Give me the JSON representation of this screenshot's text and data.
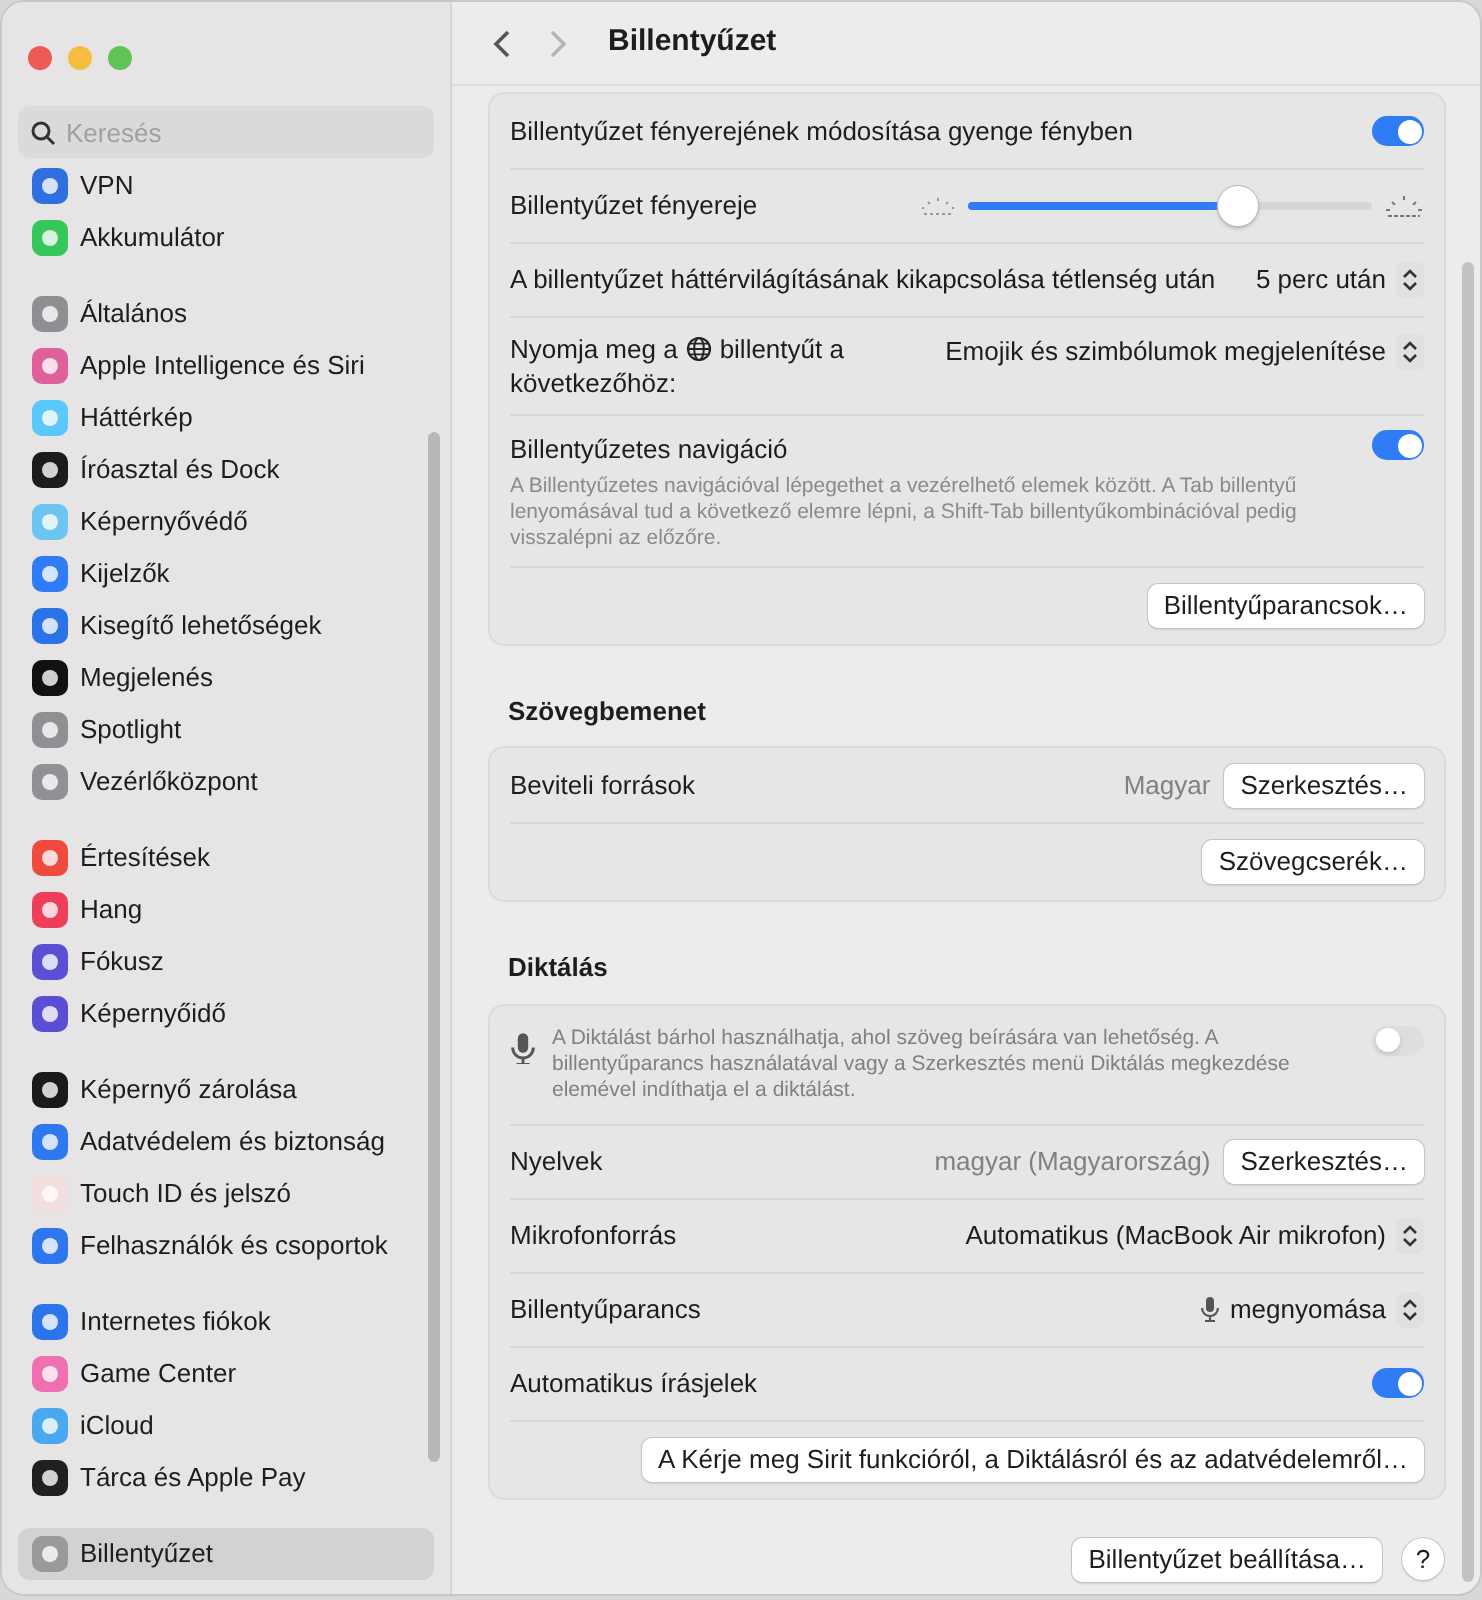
{
  "sidebar": {
    "search": {
      "placeholder": "Keresés"
    },
    "groups": [
      [
        {
          "label": "VPN",
          "color": "#2f6fe0",
          "selected": false
        },
        {
          "label": "Akkumulátor",
          "color": "#34c759",
          "selected": false
        }
      ],
      [
        {
          "label": "Általános",
          "color": "#8e8e93",
          "selected": false
        },
        {
          "label": "Apple Intelligence és Siri",
          "color": "#e0609a",
          "selected": false
        },
        {
          "label": "Háttérkép",
          "color": "#5ac8fa",
          "selected": false
        },
        {
          "label": "Íróasztal és Dock",
          "color": "#1c1c1e",
          "selected": false
        },
        {
          "label": "Képernyővédő",
          "color": "#6cc4f0",
          "selected": false
        },
        {
          "label": "Kijelzők",
          "color": "#2f7cf6",
          "selected": false
        },
        {
          "label": "Kisegítő lehetőségek",
          "color": "#2a72e8",
          "selected": false
        },
        {
          "label": "Megjelenés",
          "color": "#111111",
          "selected": false
        },
        {
          "label": "Spotlight",
          "color": "#8f8f94",
          "selected": false
        },
        {
          "label": "Vezérlőközpont",
          "color": "#909095",
          "selected": false
        }
      ],
      [
        {
          "label": "Értesítések",
          "color": "#ef4a3d",
          "selected": false
        },
        {
          "label": "Hang",
          "color": "#ef3e5b",
          "selected": false
        },
        {
          "label": "Fókusz",
          "color": "#5b4fd6",
          "selected": false
        },
        {
          "label": "Képernyőidő",
          "color": "#5a4ed4",
          "selected": false
        }
      ],
      [
        {
          "label": "Képernyő zárolása",
          "color": "#1a1a1a",
          "selected": false
        },
        {
          "label": "Adatvédelem és biztonság",
          "color": "#2e78f0",
          "selected": false
        },
        {
          "label": "Touch ID és jelszó",
          "color": "#f2dede",
          "selected": false
        },
        {
          "label": "Felhasználók és csoportok",
          "color": "#2d76ee",
          "selected": false
        }
      ],
      [
        {
          "label": "Internetes fiókok",
          "color": "#2c74ec",
          "selected": false
        },
        {
          "label": "Game Center",
          "color": "#f06fb0",
          "selected": false
        },
        {
          "label": "iCloud",
          "color": "#4aa8f0",
          "selected": false
        },
        {
          "label": "Tárca és Apple Pay",
          "color": "#202020",
          "selected": false
        }
      ],
      [
        {
          "label": "Billentyűzet",
          "color": "#9a9a9a",
          "selected": true
        }
      ]
    ]
  },
  "header": {
    "title": "Billentyűzet"
  },
  "sections": [
    {
      "rows": [
        {
          "kind": "toggle",
          "label": "Billentyűzet fényerejének módosítása gyenge fényben",
          "on": true
        },
        {
          "kind": "slider",
          "label": "Billentyűzet fényereje",
          "level": 0.67
        },
        {
          "kind": "popup",
          "label": "A billentyűzet háttérvilágításának kikapcsolása tétlenség után",
          "value": "5 perc után"
        },
        {
          "kind": "globe_popup",
          "label": "Nyomja meg a",
          "label_after": "billentyűt a",
          "label_line2": "következőhöz:",
          "value": "Emojik és szimbólumok megjelenítése"
        },
        {
          "kind": "toggle",
          "label": "Billentyűzetes navigáció",
          "description": "A Billentyűzetes navigációval lépegethet a vezérelhető elemek között. A Tab billentyű lenyomásával tud a következő elemre lépni, a Shift-Tab billentyűkombinációval pedig visszalépni az előzőre.",
          "on": true
        },
        {
          "kind": "button",
          "button": "Billentyűparancsok…"
        }
      ]
    },
    {
      "title": "Szövegbemenet",
      "rows": [
        {
          "kind": "value_button",
          "label": "Beviteli források",
          "value": "Magyar",
          "button": "Szerkesztés…"
        },
        {
          "kind": "button",
          "button": "Szövegcserék…"
        }
      ]
    },
    {
      "title": "Diktálás",
      "rows": [
        {
          "kind": "mic_toggle",
          "description": "A Diktálást bárhol használhatja, ahol szöveg beírására van lehetőség. A billentyűparancs használatával vagy a Szerkesztés menü Diktálás megkezdése elemével indíthatja el a diktálást.",
          "on": false
        },
        {
          "kind": "value_button",
          "label": "Nyelvek",
          "value": "magyar (Magyarország)",
          "button": "Szerkesztés…"
        },
        {
          "kind": "popup",
          "label": "Mikrofonforrás",
          "value": "Automatikus (MacBook Air mikrofon)"
        },
        {
          "kind": "mic_popup",
          "label": "Billentyűparancs",
          "value": "megnyomása"
        },
        {
          "kind": "toggle",
          "label": "Automatikus írásjelek",
          "on": true
        },
        {
          "kind": "button",
          "button": "A Kérje meg Sirit funkcióról, a Diktálásról és az adatvédelemről…"
        }
      ]
    }
  ],
  "footer": {
    "button": "Billentyűzet beállítása…",
    "help": "?"
  }
}
